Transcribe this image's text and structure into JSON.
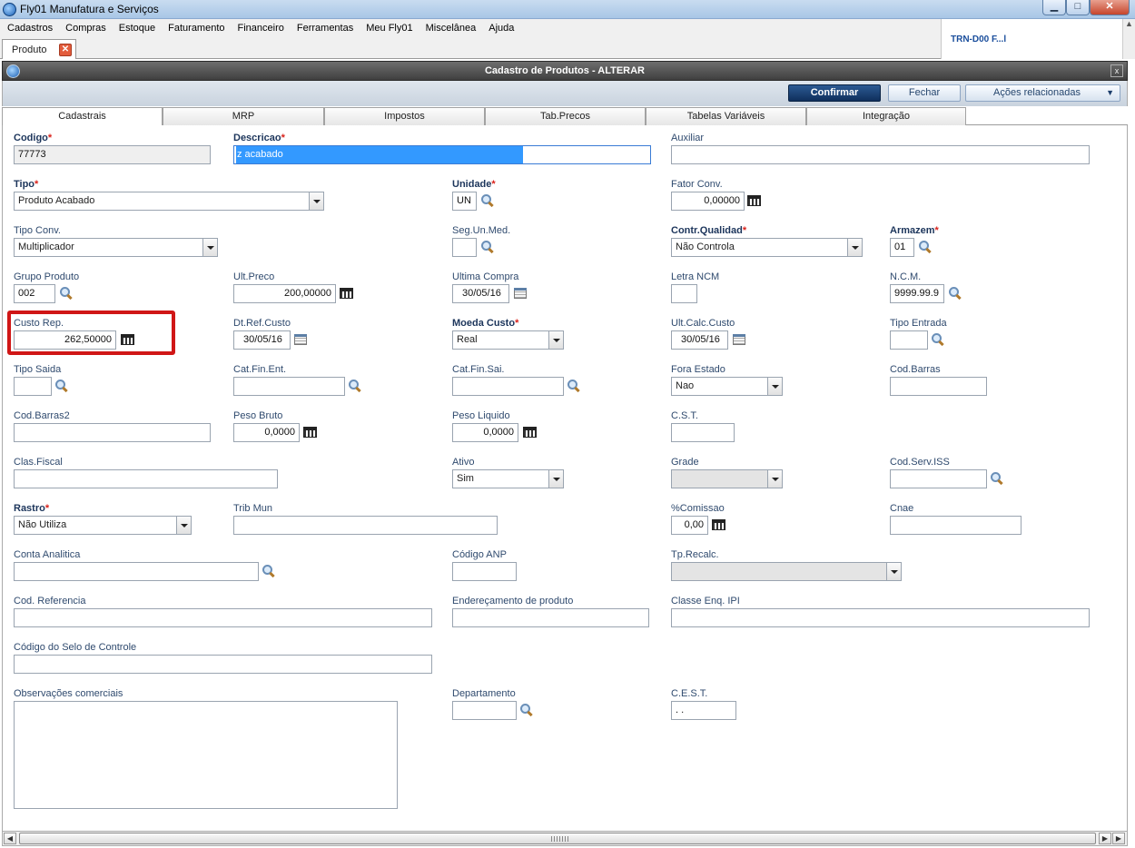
{
  "window": {
    "title": "Fly01 Manufatura e Serviços",
    "btn_min": "▁",
    "btn_max": "□",
    "btn_close": "✕"
  },
  "menu": [
    "Cadastros",
    "Compras",
    "Estoque",
    "Faturamento",
    "Financeiro",
    "Ferramentas",
    "Meu Fly01",
    "Miscelânea",
    "Ajuda"
  ],
  "side_panel": {
    "text": "TRN-D00 F...l"
  },
  "doc_tab": {
    "label": "Produto",
    "close": "✕"
  },
  "dialog": {
    "title": "Cadastro de Produtos - ALTERAR",
    "close": "x",
    "confirm_label": "Confirmar",
    "close_label": "Fechar",
    "actions_label": "Ações relacionadas",
    "actions_caret": "▼"
  },
  "tabs": [
    "Cadastrais",
    "MRP",
    "Impostos",
    "Tab.Precos",
    "Tabelas Variáveis",
    "Integração"
  ],
  "fields": {
    "codigo": {
      "label": "Codigo",
      "value": "77773"
    },
    "descricao": {
      "label": "Descricao",
      "value": "z acabado"
    },
    "auxiliar": {
      "label": "Auxiliar",
      "value": ""
    },
    "tipo": {
      "label": "Tipo",
      "value": "Produto Acabado"
    },
    "unidade": {
      "label": "Unidade",
      "value": "UN"
    },
    "fator_conv": {
      "label": "Fator Conv.",
      "value": "0,00000"
    },
    "tipo_conv": {
      "label": "Tipo Conv.",
      "value": "Multiplicador"
    },
    "seg_un_med": {
      "label": "Seg.Un.Med.",
      "value": ""
    },
    "contr_qualidad": {
      "label": "Contr.Qualidad",
      "value": "Não Controla"
    },
    "armazem": {
      "label": "Armazem",
      "value": "01"
    },
    "grupo_produto": {
      "label": "Grupo Produto",
      "value": "002"
    },
    "ult_preco": {
      "label": "Ult.Preco",
      "value": "200,00000"
    },
    "ultima_compra": {
      "label": "Ultima Compra",
      "value": "30/05/16"
    },
    "letra_ncm": {
      "label": "Letra NCM",
      "value": ""
    },
    "ncm": {
      "label": "N.C.M.",
      "value": "9999.99.9"
    },
    "custo_rep": {
      "label": "Custo Rep.",
      "value": "262,50000"
    },
    "dt_ref_custo": {
      "label": "Dt.Ref.Custo",
      "value": "30/05/16"
    },
    "moeda_custo": {
      "label": "Moeda Custo",
      "value": "Real"
    },
    "ult_calc_custo": {
      "label": "Ult.Calc.Custo",
      "value": "30/05/16"
    },
    "tipo_entrada": {
      "label": "Tipo Entrada",
      "value": ""
    },
    "tipo_saida": {
      "label": "Tipo Saida",
      "value": ""
    },
    "cat_fin_ent": {
      "label": "Cat.Fin.Ent.",
      "value": ""
    },
    "cat_fin_sai": {
      "label": "Cat.Fin.Sai.",
      "value": ""
    },
    "fora_estado": {
      "label": "Fora Estado",
      "value": "Nao"
    },
    "cod_barras": {
      "label": "Cod.Barras",
      "value": ""
    },
    "cod_barras2": {
      "label": "Cod.Barras2",
      "value": ""
    },
    "peso_bruto": {
      "label": "Peso Bruto",
      "value": "0,0000"
    },
    "peso_liquido": {
      "label": "Peso Liquido",
      "value": "0,0000"
    },
    "cst": {
      "label": "C.S.T.",
      "value": ""
    },
    "clas_fiscal": {
      "label": "Clas.Fiscal",
      "value": ""
    },
    "ativo": {
      "label": "Ativo",
      "value": "Sim"
    },
    "grade": {
      "label": "Grade",
      "value": ""
    },
    "cod_serv_iss": {
      "label": "Cod.Serv.ISS",
      "value": ""
    },
    "rastro": {
      "label": "Rastro",
      "value": "Não Utiliza"
    },
    "trib_mun": {
      "label": "Trib Mun",
      "value": ""
    },
    "comissao": {
      "label": "%Comissao",
      "value": "0,00"
    },
    "cnae": {
      "label": "Cnae",
      "value": ""
    },
    "conta_analitica": {
      "label": "Conta Analitica",
      "value": ""
    },
    "codigo_anp": {
      "label": "Código ANP",
      "value": ""
    },
    "tp_recalc": {
      "label": "Tp.Recalc.",
      "value": ""
    },
    "cod_referencia": {
      "label": "Cod. Referencia",
      "value": ""
    },
    "enderecamento": {
      "label": "Endereçamento de produto",
      "value": ""
    },
    "classe_enq_ipi": {
      "label": "Classe Enq. IPI",
      "value": ""
    },
    "codigo_selo": {
      "label": "Código do Selo de Controle",
      "value": ""
    },
    "observacoes": {
      "label": "Observações comerciais",
      "value": ""
    },
    "departamento": {
      "label": "Departamento",
      "value": ""
    },
    "cest": {
      "label": "C.E.S.T.",
      "value": " .  ."
    }
  },
  "required_marker": "*",
  "scrollbar": {
    "left": "◀",
    "right": "▶"
  }
}
